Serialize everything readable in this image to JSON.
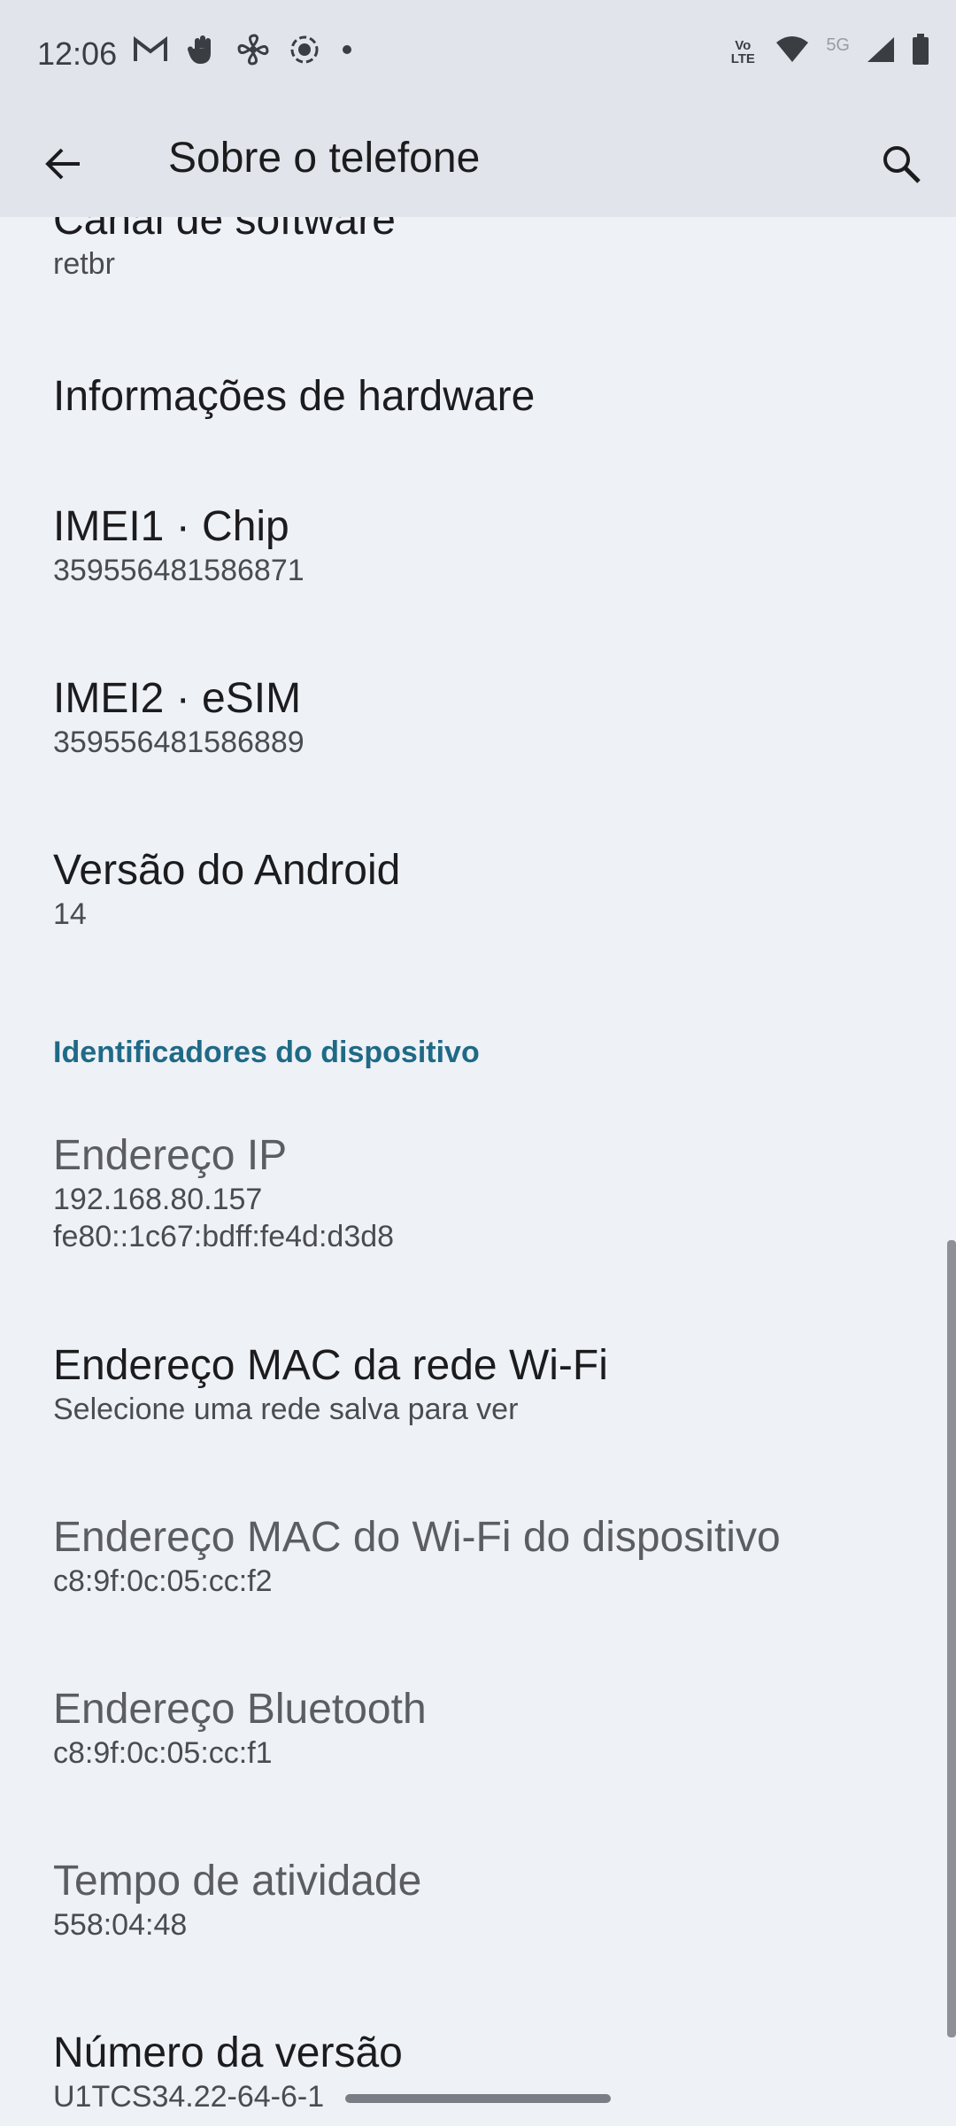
{
  "status_bar": {
    "time": "12:06",
    "left_icons": [
      "gmail-icon",
      "hand-icon",
      "fan-icon",
      "screen-record-icon",
      "dot-icon"
    ],
    "volte_label": "Vo LTE",
    "network_label": "5G"
  },
  "app_bar": {
    "title": "Sobre o telefone"
  },
  "items_top": [
    {
      "title": "Canal de software",
      "summary": "retbr"
    },
    {
      "title": "Informações de hardware",
      "summary": ""
    },
    {
      "title": "IMEI1 · Chip",
      "summary": "359556481586871"
    },
    {
      "title": "IMEI2 · eSIM",
      "summary": "359556481586889"
    },
    {
      "title": "Versão do Android",
      "summary": "14"
    }
  ],
  "section": {
    "header": "Identificadores do dispositivo"
  },
  "items_ids": [
    {
      "title": "Endereço IP",
      "summary": "192.168.80.157",
      "summary2": "fe80::1c67:bdff:fe4d:d3d8"
    },
    {
      "title": "Endereço MAC da rede Wi-Fi",
      "summary": "Selecione uma rede salva para ver"
    },
    {
      "title": "Endereço MAC do Wi-Fi do dispositivo",
      "summary": "c8:9f:0c:05:cc:f2"
    },
    {
      "title": "Endereço Bluetooth",
      "summary": "c8:9f:0c:05:cc:f1"
    },
    {
      "title": "Tempo de atividade",
      "summary": "558:04:48"
    },
    {
      "title": "Número da versão",
      "summary": "U1TCS34.22-64-6-1"
    }
  ],
  "colors": {
    "accent": "#1f6a86",
    "background": "#eef1f6",
    "app_bar": "#e1e4ea"
  }
}
